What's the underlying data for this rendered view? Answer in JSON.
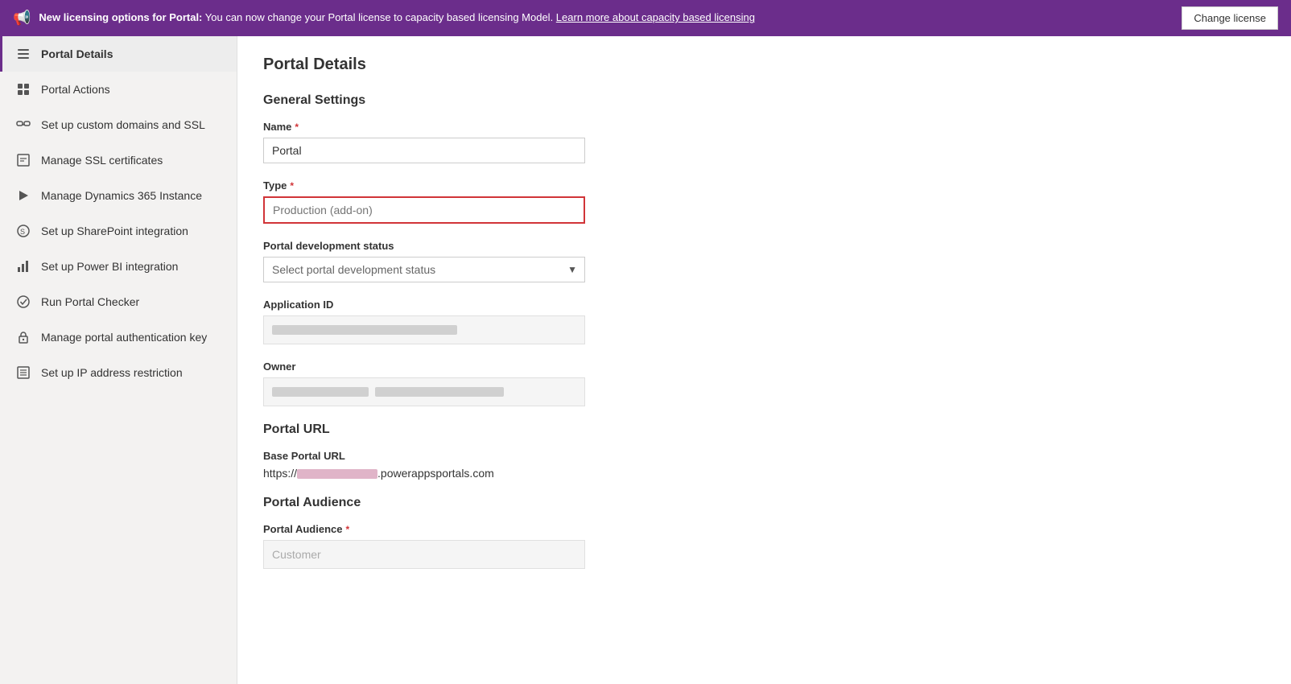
{
  "banner": {
    "icon": "📢",
    "text_bold": "New licensing options for Portal:",
    "text_normal": " You can now change your Portal license to capacity based licensing Model. ",
    "link_text": "Learn more about capacity based licensing",
    "button_label": "Change license"
  },
  "sidebar": {
    "items": [
      {
        "id": "portal-details",
        "label": "Portal Details",
        "icon": "☰",
        "active": true
      },
      {
        "id": "portal-actions",
        "label": "Portal Actions",
        "icon": "⊞"
      },
      {
        "id": "custom-domains",
        "label": "Set up custom domains and SSL",
        "icon": "🔗"
      },
      {
        "id": "ssl-certificates",
        "label": "Manage SSL certificates",
        "icon": "📄"
      },
      {
        "id": "dynamics-instance",
        "label": "Manage Dynamics 365 Instance",
        "icon": "▶"
      },
      {
        "id": "sharepoint",
        "label": "Set up SharePoint integration",
        "icon": "🔷"
      },
      {
        "id": "power-bi",
        "label": "Set up Power BI integration",
        "icon": "📊"
      },
      {
        "id": "portal-checker",
        "label": "Run Portal Checker",
        "icon": "✔"
      },
      {
        "id": "auth-key",
        "label": "Manage portal authentication key",
        "icon": "🔒"
      },
      {
        "id": "ip-restriction",
        "label": "Set up IP address restriction",
        "icon": "📋"
      }
    ]
  },
  "main": {
    "page_title": "Portal Details",
    "general_settings_title": "General Settings",
    "fields": {
      "name_label": "Name",
      "name_required": "*",
      "name_value": "Portal",
      "type_label": "Type",
      "type_required": "*",
      "type_placeholder": "Production (add-on)",
      "dev_status_label": "Portal development status",
      "dev_status_placeholder": "Select portal development status",
      "app_id_label": "Application ID",
      "owner_label": "Owner"
    },
    "portal_url_title": "Portal URL",
    "base_url_label": "Base Portal URL",
    "base_url_prefix": "https://",
    "base_url_suffix": ".powerappsportals.com",
    "portal_audience_title": "Portal Audience",
    "audience_label": "Portal Audience",
    "audience_required": "*",
    "audience_value": "Customer"
  }
}
